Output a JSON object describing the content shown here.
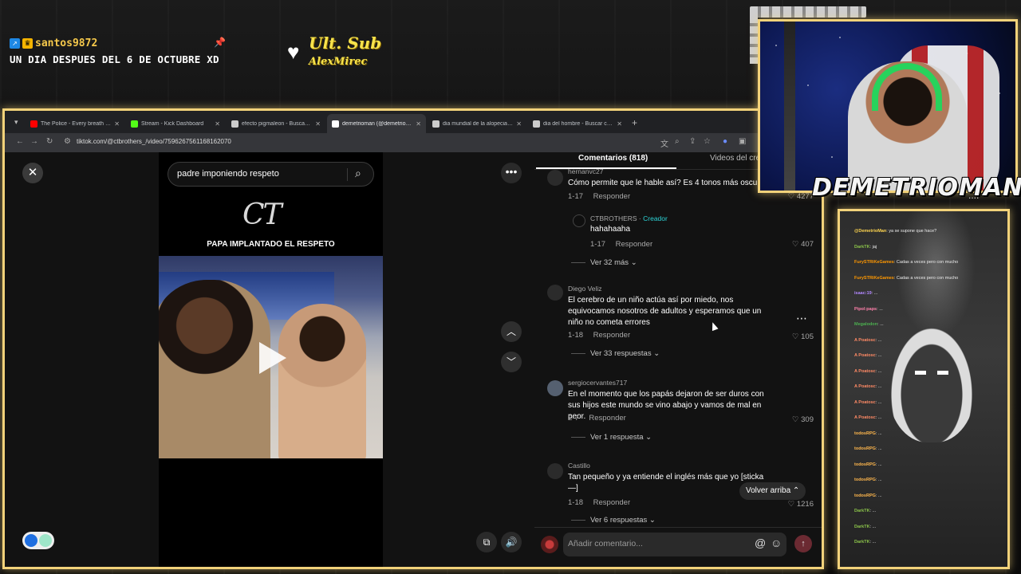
{
  "overlay": {
    "username": "santos9872",
    "chat_message": "UN DIA DESPUES DEL 6 DE OCTUBRE XD",
    "last_sub_label": "Ult. Sub",
    "last_sub_name": "AlexMirec",
    "streamer_name": "DEMETRIOMAN",
    "streamer_suffix": "....",
    "icons": [
      "kick-icon",
      "crown-icon",
      "pin-icon",
      "heart-icon"
    ]
  },
  "browser": {
    "tabs": [
      {
        "title": "The Police - Every breath you take",
        "favicon_color": "#ff0000"
      },
      {
        "title": "Stream - Kick Dashboard",
        "favicon_color": "#53fc18"
      },
      {
        "title": "efecto pigmaleon - Buscar con Google",
        "favicon_color": "#cccccc"
      },
      {
        "title": "demetrioman (@demetrioman)",
        "favicon_color": "#ffffff",
        "active": true
      },
      {
        "title": "dia mundial de la alopecia - Buscar",
        "favicon_color": "#cccccc"
      },
      {
        "title": "dia del hombre - Buscar con Google",
        "favicon_color": "#cccccc"
      }
    ],
    "url": "tiktok.com/@ctbrothers_/video/7596267561168162070"
  },
  "tiktok": {
    "search_text": "padre imponiendo respeto",
    "logo_text": "CT",
    "video_caption": "PAPA IMPLANTADO EL RESPETO",
    "tabs": {
      "comments": "Comentarios (818)",
      "videos": "Videos del cre"
    },
    "comments": [
      {
        "user": "hernanvc27",
        "text": "Cómo permite que le hable así? Es 4 tonos más oscu",
        "date": "1-17",
        "reply": "Responder",
        "likes": "4277"
      },
      {
        "user": "CTBROTHERS",
        "creator": "Creador",
        "text": "hahahaaha",
        "date": "1-17",
        "reply": "Responder",
        "likes": "407",
        "more_replies": "Ver 32 más"
      },
      {
        "user": "Diego Veliz",
        "text": "El cerebro de un niño actúa así por miedo, nos equivocamos nosotros de adultos y esperamos que un niño no cometa errores",
        "date": "1-18",
        "reply": "Responder",
        "likes": "105",
        "more_replies": "Ver 33 respuestas"
      },
      {
        "user": "sergiocervantes717",
        "text": "En el momento que los papás dejaron de ser duros con sus hijos este mundo se vino abajo y vamos de mal en peor.",
        "date": "2-7",
        "reply": "Responder",
        "likes": "309",
        "more_replies": "Ver 1 respuesta"
      },
      {
        "user": "Castillo",
        "text": "Tan pequeño y ya entiende el inglés más que yo [sticka —]",
        "date": "1-18",
        "reply": "Responder",
        "likes": "1216",
        "more_replies": "Ver 6 respuestas"
      }
    ],
    "back_to_top": "Volver arriba",
    "comment_placeholder": "Añadir comentario..."
  },
  "chat_panel": {
    "lines": [
      {
        "name": "@DemetrioMan",
        "text": "ya se supone que hace?",
        "color": "#ffd54f"
      },
      {
        "name": "DarkTK",
        "text": "jaj",
        "color": "#8bc34a"
      },
      {
        "name": "FurySTRiKeGames",
        "text": "Cadas a veces pero con mucho",
        "color": "#ff9800"
      },
      {
        "name": "FurySTRiKeGames",
        "text": "Cadas a veces pero con mucho",
        "color": "#ff9800"
      },
      {
        "name": "isaac:19",
        "text": "...",
        "color": "#b388ff"
      },
      {
        "name": "Pipol:paps",
        "text": "...",
        "color": "#ff80ab"
      },
      {
        "name": "Megalodon",
        "text": "...",
        "color": "#4caf50"
      },
      {
        "name": "A Poatosc",
        "text": "...",
        "color": "#ff8a65"
      },
      {
        "name": "A Poatosc",
        "text": "...",
        "color": "#ff8a65"
      },
      {
        "name": "A Poatosc",
        "text": "...",
        "color": "#ff8a65"
      },
      {
        "name": "A Poatosc",
        "text": "...",
        "color": "#ff8a65"
      },
      {
        "name": "A Poatosc",
        "text": "...",
        "color": "#ff8a65"
      },
      {
        "name": "A Poatosc",
        "text": "...",
        "color": "#ff8a65"
      },
      {
        "name": "todosRPG",
        "text": "...",
        "color": "#ffb74d"
      },
      {
        "name": "todosRPG",
        "text": "...",
        "color": "#ffb74d"
      },
      {
        "name": "todosRPG",
        "text": "...",
        "color": "#ffb74d"
      },
      {
        "name": "todosRPG",
        "text": "...",
        "color": "#ffb74d"
      },
      {
        "name": "todosRPG",
        "text": "...",
        "color": "#ffb74d"
      },
      {
        "name": "DarkTK",
        "text": "...",
        "color": "#8bc34a"
      },
      {
        "name": "DarkTK",
        "text": "...",
        "color": "#8bc34a"
      },
      {
        "name": "DarkTK",
        "text": "...",
        "color": "#8bc34a"
      }
    ]
  },
  "colors": {
    "frame_gold": "#f2d27a",
    "creator_cyan": "#2dd4d7",
    "sub_yellow": "#f7e34b"
  }
}
